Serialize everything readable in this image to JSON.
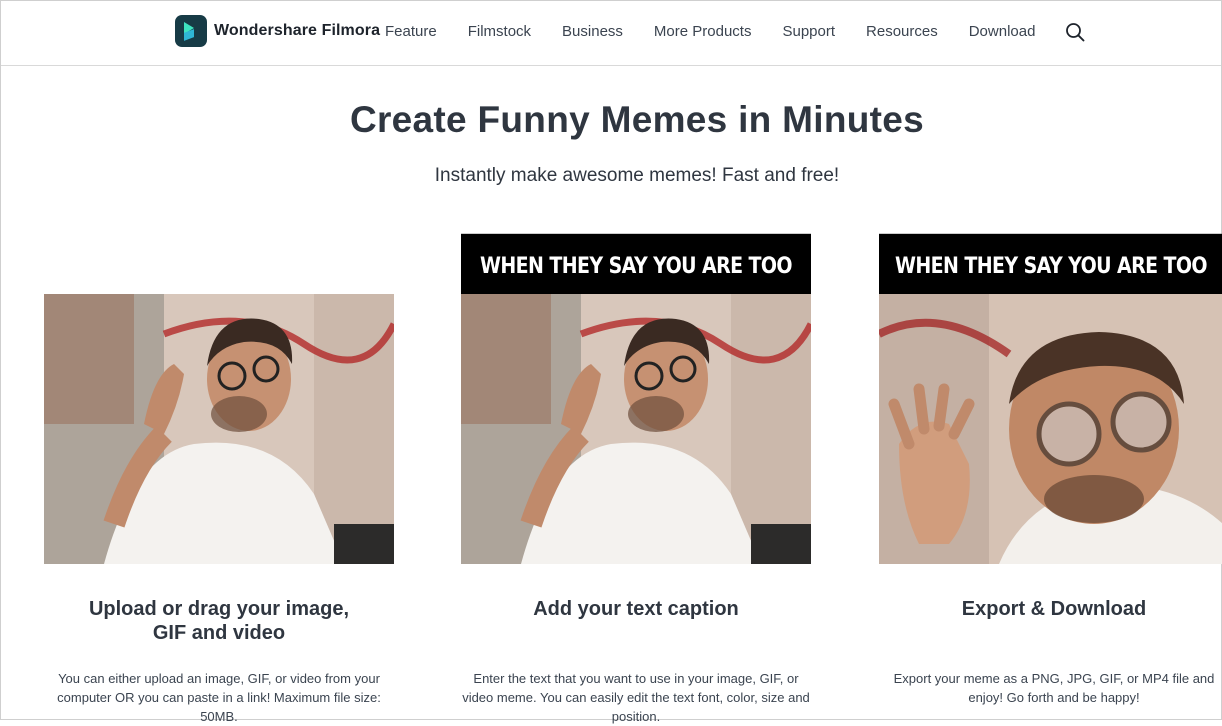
{
  "nav": {
    "brand": "Wondershare Filmora",
    "items": [
      "Feature",
      "Filmstock",
      "Business",
      "More Products",
      "Support",
      "Resources",
      "Download"
    ]
  },
  "hero": {
    "title": "Create Funny Memes in Minutes",
    "subtitle": "Instantly make awesome memes! Fast and free!"
  },
  "steps": [
    {
      "title_line1": "Upload or drag your image,",
      "title_line2": "GIF and video",
      "description": "You can either upload an image, GIF, or video from your computer OR you can paste in a link! Maximum file size: 50MB."
    },
    {
      "caption": "WHEN THEY SAY YOU ARE TOO MUCH",
      "title_line1": "Add your text caption",
      "description": "Enter the text that you want to use in your image, GIF, or video meme. You can easily edit the text font, color, size and position."
    },
    {
      "caption": "WHEN THEY SAY YOU ARE TOO MUCH",
      "title_line1": "Export & Download",
      "description": "Export your meme as a PNG, JPG, GIF, or MP4 file and enjoy! Go forth and be happy!"
    }
  ],
  "colors": {
    "heading": "#2f3640",
    "logo_bg": "#173b46",
    "caption_bg": "#000000"
  }
}
